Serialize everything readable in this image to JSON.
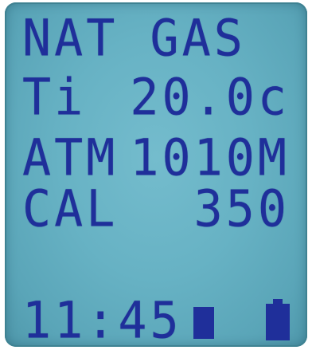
{
  "display": {
    "line1": {
      "label": "NAT GAS"
    },
    "line2": {
      "label": "Ti",
      "value": "20.0c"
    },
    "line3": {
      "label": "ATM",
      "value": "1010M"
    },
    "line4": {
      "label": "CAL",
      "value": "350"
    },
    "status": {
      "time": "11:45"
    }
  },
  "colors": {
    "lcd_background": "#67b2c4",
    "segment_text": "#1f2f9a"
  },
  "icons": [
    "block-indicator-icon",
    "battery-icon"
  ]
}
